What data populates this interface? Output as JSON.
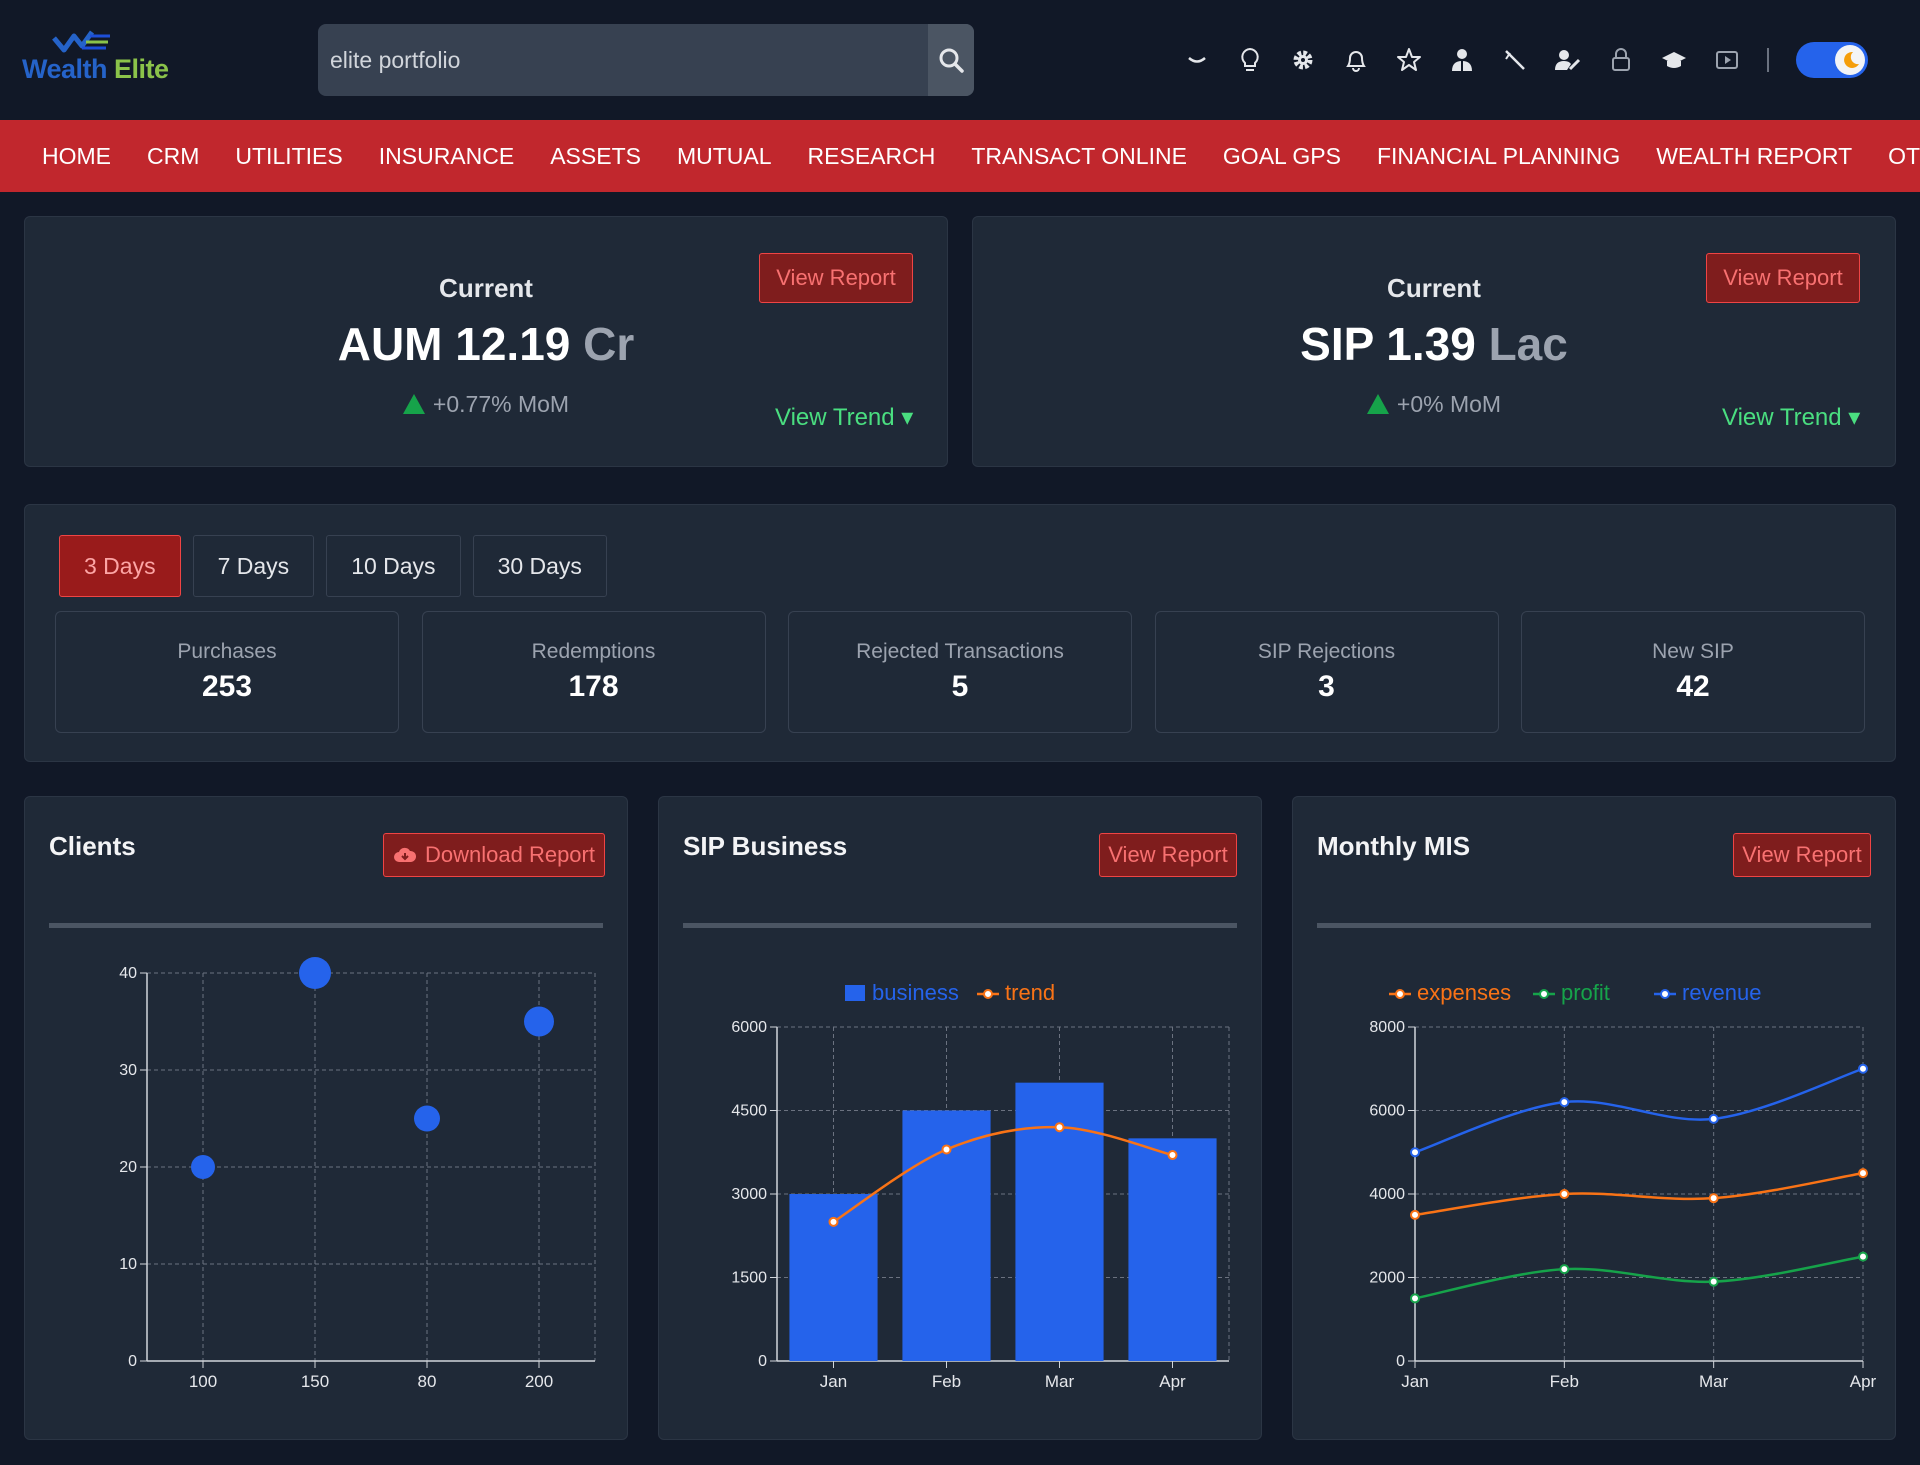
{
  "app": {
    "logo_text_1": "Wealth",
    "logo_text_2": "Elite"
  },
  "search": {
    "value": "elite portfolio",
    "placeholder": "elite portfolio"
  },
  "header_icons": [
    "chevron-down-icon",
    "lightbulb-icon",
    "gear-icon",
    "bell-icon",
    "star-icon",
    "user-group-icon",
    "pen-icon",
    "user-edit-icon",
    "lock-icon",
    "graduation-cap-icon",
    "video-icon"
  ],
  "theme_toggle": {
    "state": "dark",
    "icon": "moon-icon"
  },
  "nav": [
    "HOME",
    "CRM",
    "UTILITIES",
    "INSURANCE",
    "ASSETS",
    "MUTUAL",
    "RESEARCH",
    "TRANSACT ONLINE",
    "GOAL GPS",
    "FINANCIAL PLANNING",
    "WEALTH REPORT",
    "OTHER"
  ],
  "aum": {
    "label": "Current",
    "prefix": "AUM 12.19",
    "unit": "Cr",
    "mom": "+0.77% MoM",
    "report_btn": "View Report",
    "trend_btn": "View Trend ▾"
  },
  "sip": {
    "label": "Current",
    "prefix": "SIP 1.39",
    "unit": "Lac",
    "mom": "+0% MoM",
    "report_btn": "View Report",
    "trend_btn": "View Trend ▾"
  },
  "period_tabs": [
    "3 Days",
    "7 Days",
    "10 Days",
    "30 Days"
  ],
  "active_period": "3 Days",
  "stats": [
    {
      "label": "Purchases",
      "value": "253"
    },
    {
      "label": "Redemptions",
      "value": "178"
    },
    {
      "label": "Rejected Transactions",
      "value": "5"
    },
    {
      "label": "SIP Rejections",
      "value": "3"
    },
    {
      "label": "New SIP",
      "value": "42"
    }
  ],
  "panels": {
    "clients": {
      "title": "Clients",
      "button": "Download Report"
    },
    "sip_business": {
      "title": "SIP Business",
      "button": "View Report"
    },
    "monthly_mis": {
      "title": "Monthly MIS",
      "button": "View Report"
    }
  },
  "colors": {
    "accent_red": "#c1272d",
    "blue": "#2563eb",
    "orange": "#f97316",
    "green": "#16a34a",
    "trend_green": "#4ade80"
  },
  "chart_data": [
    {
      "type": "scatter",
      "categories": [
        "100",
        "150",
        "80",
        "200"
      ],
      "values": [
        20,
        40,
        25,
        35
      ],
      "ylim": [
        0,
        40
      ],
      "yticks": [
        0,
        10,
        20,
        30,
        40
      ],
      "grid": true
    },
    {
      "type": "bar",
      "categories": [
        "Jan",
        "Feb",
        "Mar",
        "Apr"
      ],
      "series": [
        {
          "name": "business",
          "type": "bar",
          "values": [
            3000,
            4500,
            5000,
            4000
          ]
        },
        {
          "name": "trend",
          "type": "line",
          "values": [
            2500,
            3800,
            4200,
            3700
          ]
        }
      ],
      "ylim": [
        0,
        6000
      ],
      "yticks": [
        0,
        1500,
        3000,
        4500,
        6000
      ],
      "legend": "top",
      "grid": true
    },
    {
      "type": "line",
      "categories": [
        "Jan",
        "Feb",
        "Mar",
        "Apr"
      ],
      "series": [
        {
          "name": "expenses",
          "values": [
            3500,
            4000,
            3900,
            4500
          ]
        },
        {
          "name": "profit",
          "values": [
            1500,
            2200,
            1900,
            2500
          ]
        },
        {
          "name": "revenue",
          "values": [
            5000,
            6200,
            5800,
            7000
          ]
        }
      ],
      "ylim": [
        0,
        8000
      ],
      "yticks": [
        0,
        2000,
        4000,
        6000,
        8000
      ],
      "legend": "top",
      "grid": true
    }
  ]
}
